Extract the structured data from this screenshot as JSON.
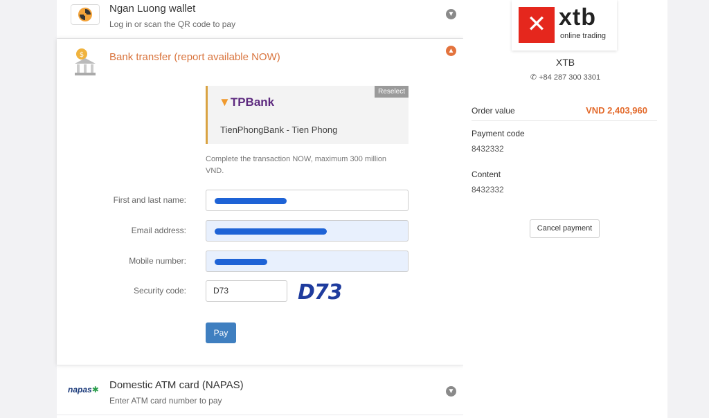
{
  "methods": {
    "wallet": {
      "title": "Ngan Luong wallet",
      "subtitle": "Log in or scan the QR code to pay"
    },
    "bank_transfer": {
      "title": "Bank transfer (report available NOW)"
    },
    "atm": {
      "title": "Domestic ATM card (NAPAS)",
      "subtitle": "Enter ATM card number to pay",
      "logo_text": "napas"
    }
  },
  "bank": {
    "reselect_label": "Reselect",
    "logo_text": "TPBank",
    "name": "TienPhongBank - Tien Phong"
  },
  "note": "Complete the transaction NOW, maximum 300 million VND.",
  "form": {
    "name_label": "First and last name:",
    "email_label": "Email address:",
    "mobile_label": "Mobile number:",
    "security_label": "Security code:",
    "security_value": "D73",
    "captcha_text": "D73",
    "pay_label": "Pay"
  },
  "merchant": {
    "logo_word": "xtb",
    "logo_sub": "online trading",
    "name": "XTB",
    "phone": "+84 287 300 3301"
  },
  "order": {
    "value_label": "Order value",
    "value": "VND 2,403,960",
    "payment_code_label": "Payment code",
    "payment_code": "8432332",
    "content_label": "Content",
    "content": "8432332",
    "cancel_label": "Cancel payment"
  },
  "icons": [
    "chevron-down-icon",
    "chevron-up-icon",
    "phone-icon",
    "bank-icon",
    "wallet-icon"
  ],
  "colors": {
    "accent": "#d9743d",
    "pay_button": "#3f7fc0",
    "order_value": "#e36a2b"
  }
}
